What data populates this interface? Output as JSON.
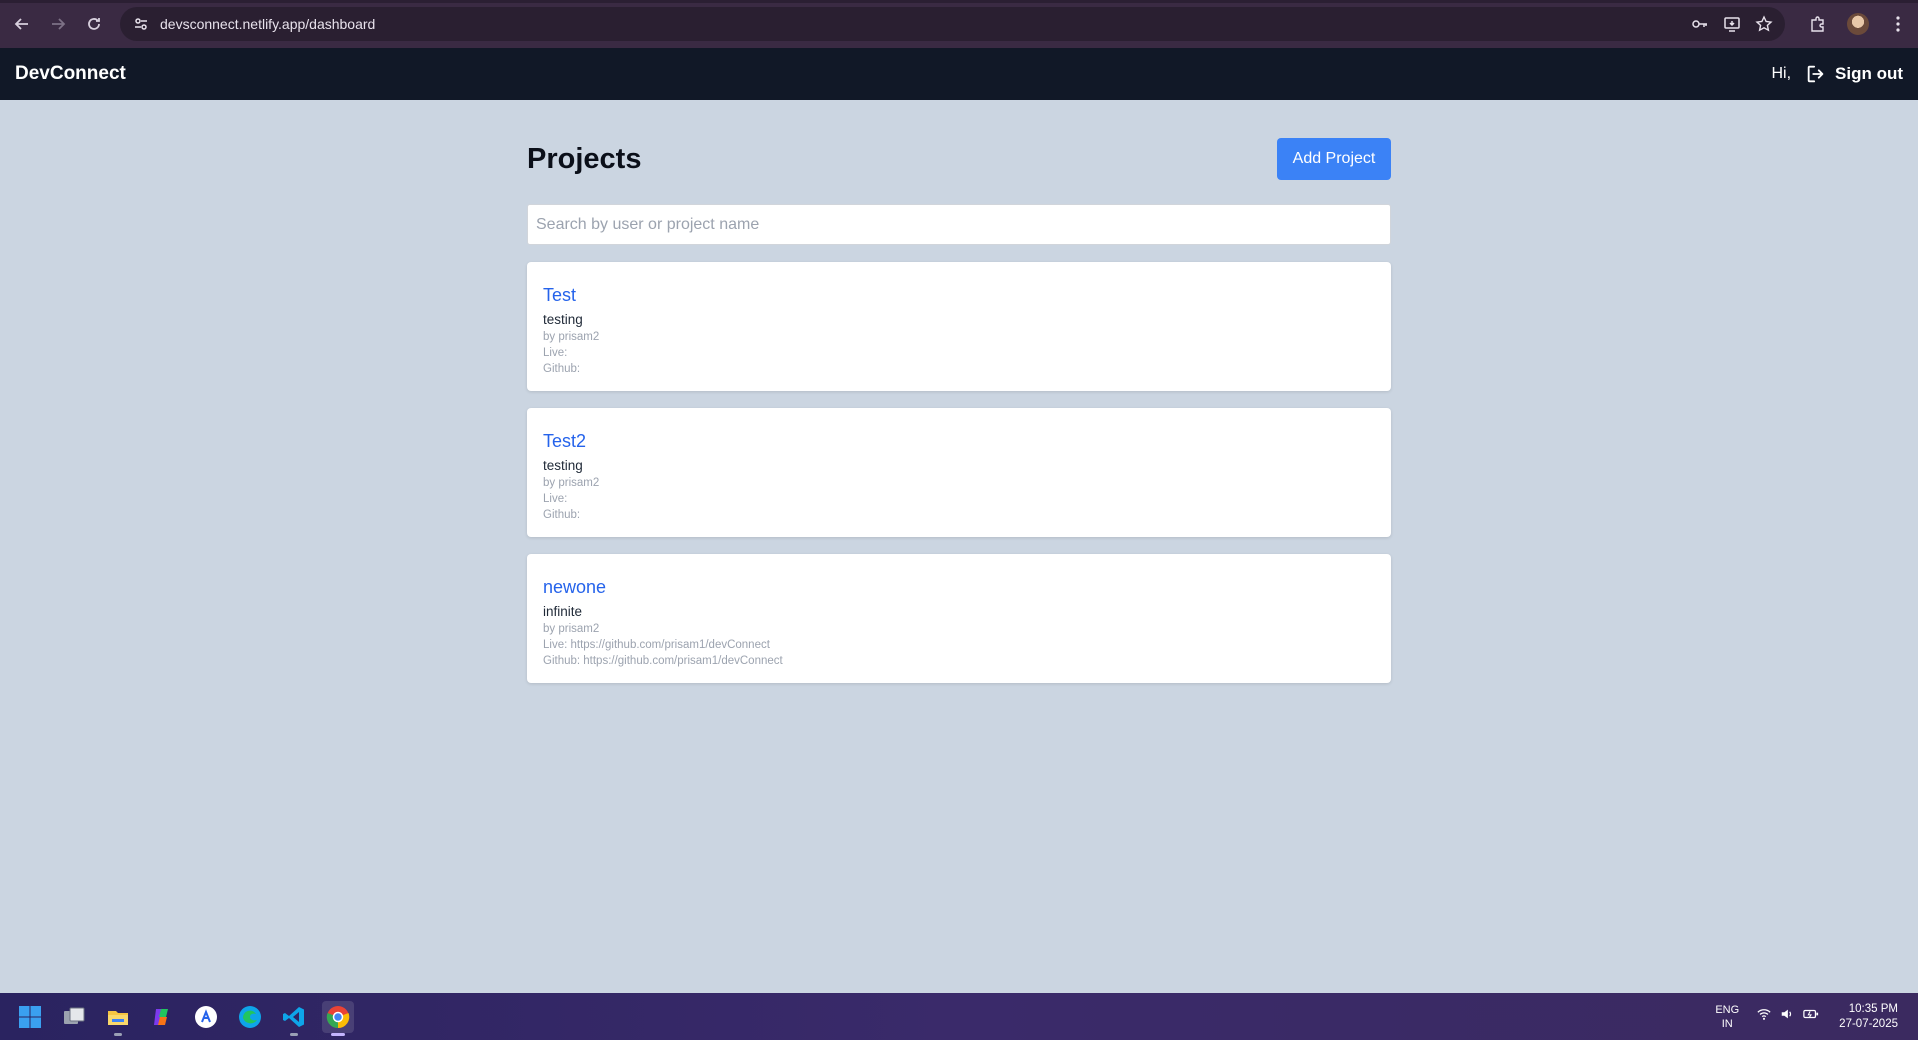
{
  "browser": {
    "url": "devsconnect.netlify.app/dashboard"
  },
  "app": {
    "brand": "DevConnect",
    "greeting": "Hi,",
    "signout_label": "Sign out"
  },
  "main": {
    "title": "Projects",
    "add_button_label": "Add Project",
    "search_placeholder": "Search by user or project name",
    "projects": [
      {
        "title": "Test",
        "description": "testing",
        "author": "by prisam2",
        "live": "Live:",
        "github": "Github:"
      },
      {
        "title": "Test2",
        "description": "testing",
        "author": "by prisam2",
        "live": "Live:",
        "github": "Github:"
      },
      {
        "title": "newone",
        "description": "infinite",
        "author": "by prisam2",
        "live": "Live: https://github.com/prisam1/devConnect",
        "github": "Github: https://github.com/prisam1/devConnect"
      }
    ]
  },
  "taskbar": {
    "apps": [
      "start-icon",
      "task-view-icon",
      "file-explorer-icon",
      "copilot-icon",
      "app-store-icon",
      "edge-icon",
      "vscode-icon",
      "chrome-icon"
    ],
    "lang_primary": "ENG",
    "lang_secondary": "IN",
    "time": "10:35 PM",
    "date": "27-07-2025"
  },
  "colors": {
    "page_bg": "#cbd5e1",
    "navbar_bg": "#111827",
    "accent": "#3b82f6",
    "link": "#2563eb"
  }
}
